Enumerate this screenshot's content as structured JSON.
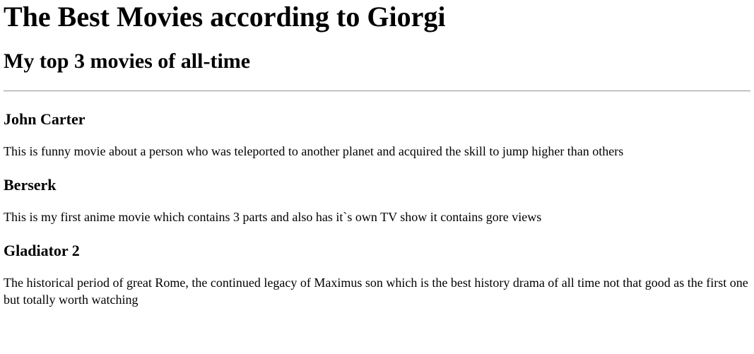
{
  "page": {
    "title": "The Best Movies according to Giorgi",
    "subtitle": "My top 3 movies of all-time"
  },
  "movies": [
    {
      "title": "John Carter",
      "description": "This is funny movie about a person who was teleported to another planet and acquired the skill to jump higher than others"
    },
    {
      "title": "Berserk",
      "description": "This is my first anime movie which contains 3 parts and also has it`s own TV show it contains gore views"
    },
    {
      "title": "Gladiator 2",
      "description": "The historical period of great Rome, the continued legacy of Maximus son which is the best history drama of all time not that good as the first one but totally worth watching"
    }
  ]
}
